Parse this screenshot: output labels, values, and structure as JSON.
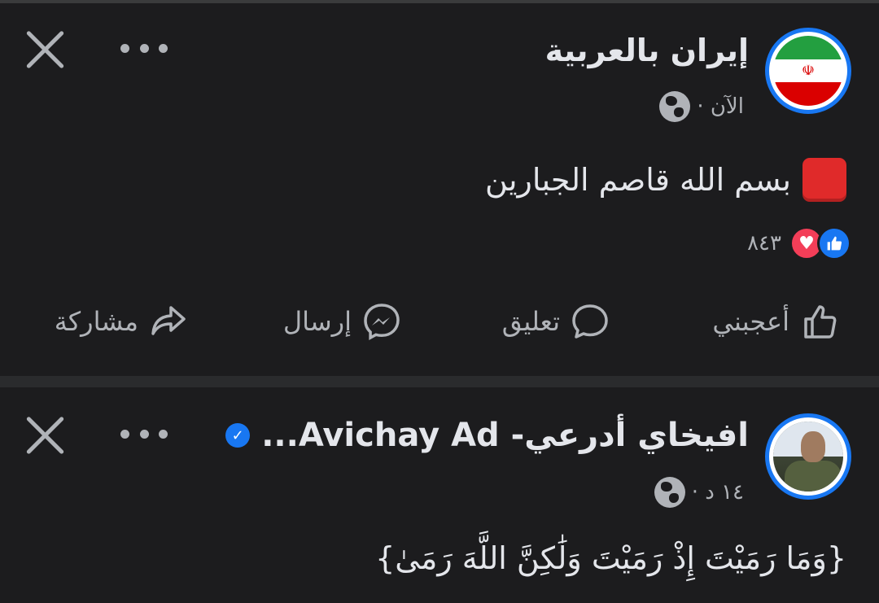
{
  "posts": [
    {
      "author": "إيران بالعربية",
      "timestamp": "الآن ·",
      "body": "بسم الله قاصم الجبارين",
      "reaction_count": "٨٤٣",
      "actions": {
        "like": "أعجبني",
        "comment": "تعليق",
        "send": "إرسال",
        "share": "مشاركة"
      }
    },
    {
      "author_arabic": "افيخاي أدرعي-",
      "author_latin": "Avichay Ad...",
      "timestamp": "١٤ د ·",
      "body": "{وَمَا رَمَيْتَ إِذْ رَمَيْتَ وَلَٰكِنَّ اللَّهَ رَمَىٰ}"
    }
  ],
  "icons": {
    "close": "close-icon",
    "more": "more-icon",
    "globe": "globe-icon",
    "like": "thumbs-up-icon",
    "love": "heart-icon",
    "comment": "comment-bubble-icon",
    "send": "messenger-icon",
    "share": "share-arrow-icon",
    "verified": "verified-badge-icon"
  },
  "colors": {
    "background": "#1c1c1e",
    "accent": "#1877f2",
    "secondary_text": "#b0b3b8"
  }
}
